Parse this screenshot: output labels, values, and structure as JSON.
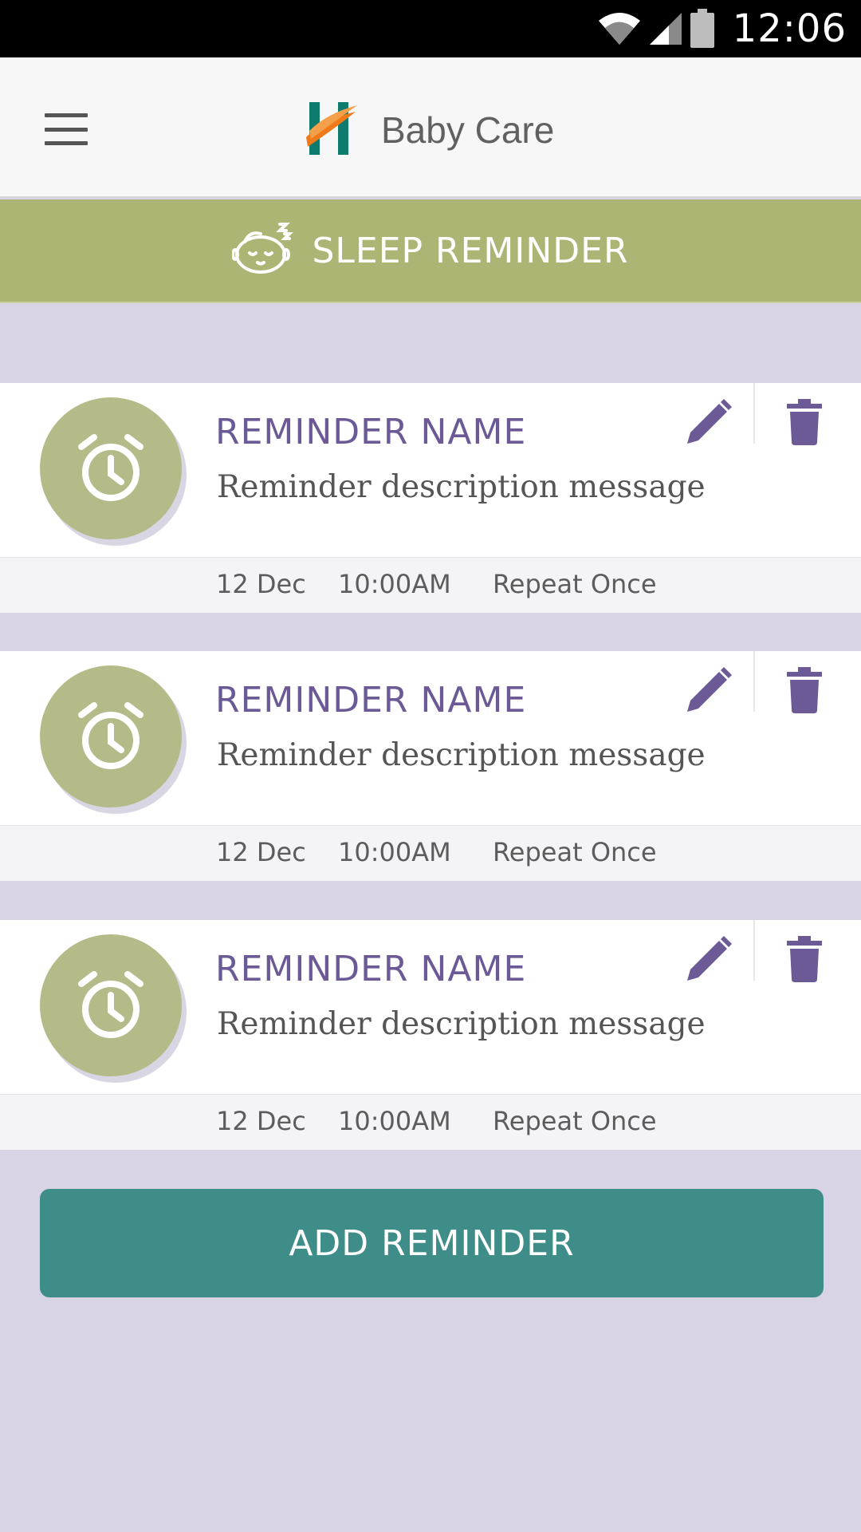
{
  "status_bar": {
    "time": "12:06",
    "icons": [
      "wifi-icon",
      "cellular-signal-icon",
      "battery-icon"
    ]
  },
  "app_bar": {
    "menu_icon": "hamburger-menu-icon",
    "logo_icon": "app-logo",
    "title": "Baby Care"
  },
  "banner": {
    "icon": "sleeping-baby-icon",
    "title": "SLEEP REMINDER"
  },
  "reminders": [
    {
      "name": "REMINDER NAME",
      "description": "Reminder description message",
      "date": "12 Dec",
      "time": "10:00AM",
      "repeat": "Repeat Once"
    },
    {
      "name": "REMINDER NAME",
      "description": "Reminder description message",
      "date": "12 Dec",
      "time": "10:00AM",
      "repeat": "Repeat Once"
    },
    {
      "name": "REMINDER NAME",
      "description": "Reminder description message",
      "date": "12 Dec",
      "time": "10:00AM",
      "repeat": "Repeat Once"
    }
  ],
  "card_icons": {
    "alarm": "alarm-clock-icon",
    "edit": "pencil-icon",
    "delete": "trash-icon"
  },
  "add_button": {
    "label": "ADD REMINDER"
  },
  "colors": {
    "app_bar_bg": "#f7f7f7",
    "banner_bg": "#adb575",
    "page_bg": "#d8d4e6",
    "accent_purple": "#6b5a95",
    "alarm_circle": "#b5bb88",
    "add_button_bg": "#3f8d88",
    "logo_teal": "#0f7a6e",
    "logo_orange": "#f07a1a"
  }
}
